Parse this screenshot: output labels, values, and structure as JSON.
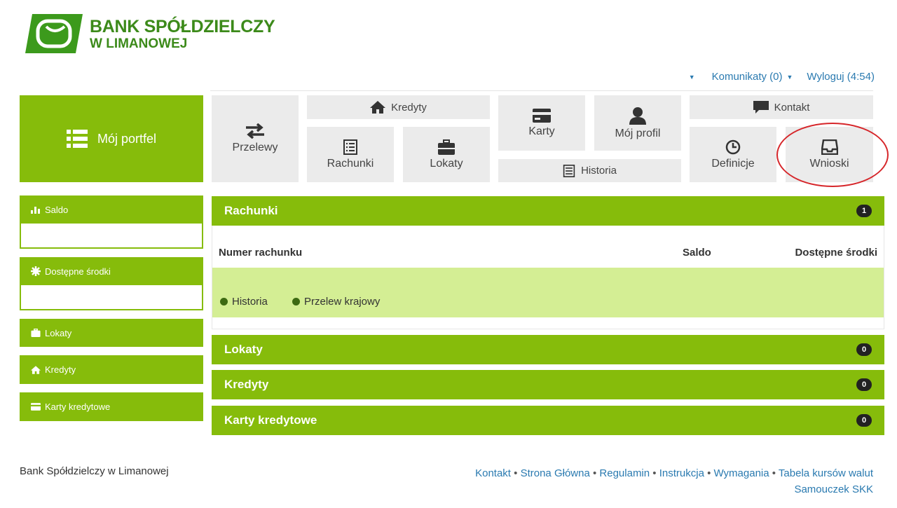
{
  "brand": {
    "line1": "BANK SPÓŁDZIELCZY",
    "line2": "W LIMANOWEJ",
    "color": "#3c8a1a"
  },
  "topnav": {
    "komunikaty": "Komunikaty (0)",
    "wyloguj": "Wyloguj (4:54)"
  },
  "tiles": {
    "portfel": "Mój portfel",
    "przelewy": "Przelewy",
    "kredyty": "Kredyty",
    "rachunki": "Rachunki",
    "lokaty": "Lokaty",
    "karty": "Karty",
    "profil": "Mój profil",
    "historia": "Historia",
    "kontakt": "Kontakt",
    "definicje": "Definicje",
    "wnioski": "Wnioski"
  },
  "sidebar": {
    "saldo": "Saldo",
    "dostepne": "Dostępne środki",
    "lokaty": "Lokaty",
    "kredyty": "Kredyty",
    "karty": "Karty kredytowe"
  },
  "panels": {
    "rachunki": {
      "title": "Rachunki",
      "count": "1"
    },
    "lokaty": {
      "title": "Lokaty",
      "count": "0"
    },
    "kredyty": {
      "title": "Kredyty",
      "count": "0"
    },
    "karty": {
      "title": "Karty kredytowe",
      "count": "0"
    }
  },
  "table": {
    "col_numer": "Numer rachunku",
    "col_saldo": "Saldo",
    "col_dostepne": "Dostępne środki",
    "link_historia": "Historia",
    "link_przelew": "Przelew krajowy"
  },
  "footer": {
    "bank": "Bank Spółdzielczy w Limanowej",
    "links": [
      "Kontakt",
      "Strona Główna",
      "Regulamin",
      "Instrukcja",
      "Wymagania",
      "Tabela kursów walut"
    ],
    "samouczek": "Samouczek SKK"
  },
  "colors": {
    "accent": "#86bc0b",
    "tile": "#ebebeb",
    "row_highlight": "#d4ee94",
    "link": "#2a7ab0",
    "annotation": "#d6262a"
  }
}
